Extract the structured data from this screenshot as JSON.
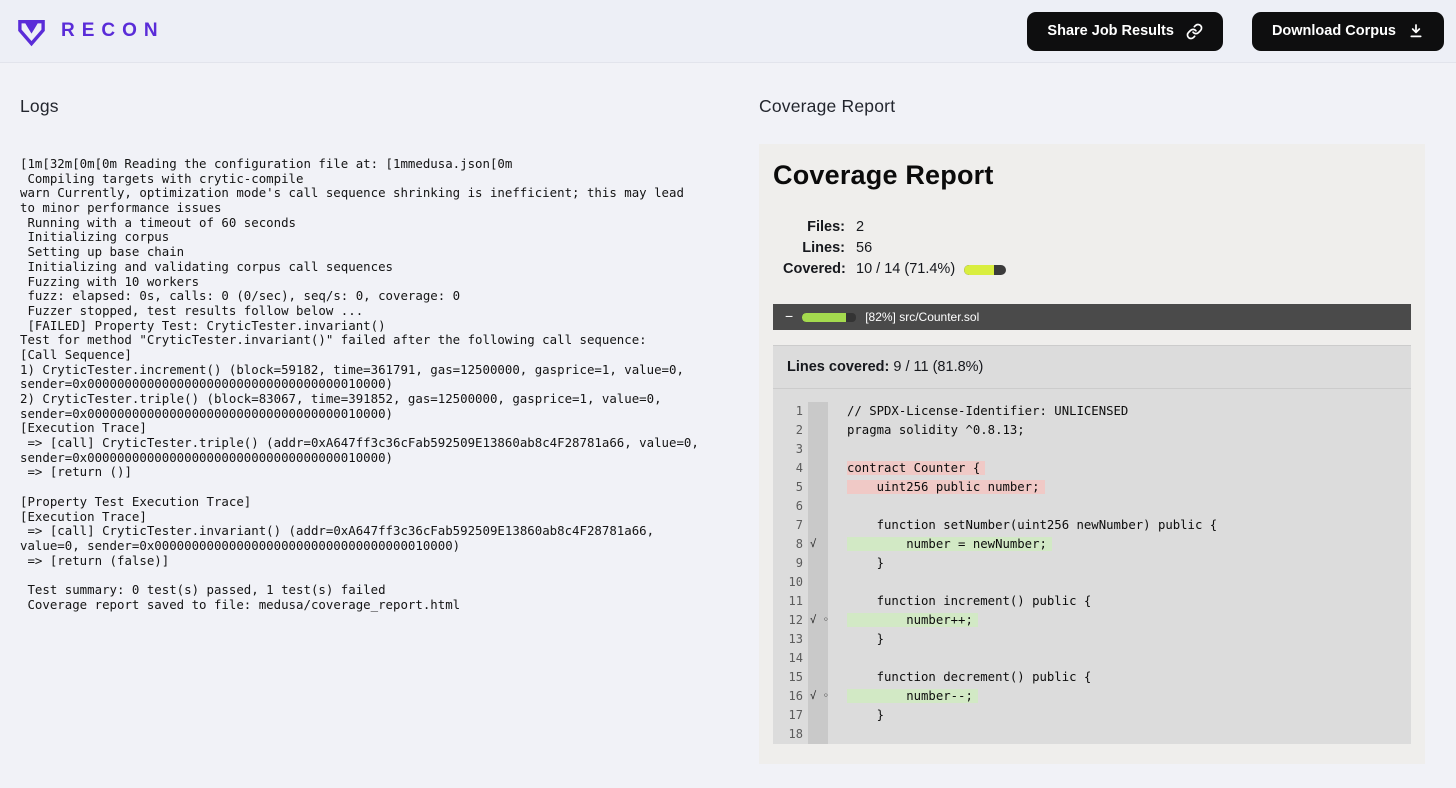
{
  "colors": {
    "accent_purple": "#5a2cd8",
    "button_black": "#0e0e0f",
    "covered_bar_fill": "#d9ee3f",
    "file_bar_fill": "#a4da4e",
    "uncovered_line_bg": "#f0c9c6",
    "covered_line_bg": "#d2e9c5",
    "file_header_bg": "#4a4a4a"
  },
  "navbar": {
    "brand": "RECON",
    "share_button_label": "Share Job Results",
    "download_button_label": "Download Corpus"
  },
  "logs": {
    "title": "Logs",
    "lines": [
      "[1m[32m[0m[0m Reading the configuration file at: [1mmedusa.json[0m",
      " Compiling targets with crytic-compile",
      "warn Currently, optimization mode's call sequence shrinking is inefficient; this may lead to minor performance issues",
      " Running with a timeout of 60 seconds",
      " Initializing corpus",
      " Setting up base chain",
      " Initializing and validating corpus call sequences",
      " Fuzzing with 10 workers",
      " fuzz: elapsed: 0s, calls: 0 (0/sec), seq/s: 0, coverage: 0",
      " Fuzzer stopped, test results follow below ...",
      " [FAILED] Property Test: CryticTester.invariant()",
      "Test for method \"CryticTester.invariant()\" failed after the following call sequence:",
      "[Call Sequence]",
      "1) CryticTester.increment() (block=59182, time=361791, gas=12500000, gasprice=1, value=0, sender=0x0000000000000000000000000000000000010000)",
      "2) CryticTester.triple() (block=83067, time=391852, gas=12500000, gasprice=1, value=0, sender=0x0000000000000000000000000000000000010000)",
      "[Execution Trace]",
      " => [call] CryticTester.triple() (addr=0xA647ff3c36cFab592509E13860ab8c4F28781a66, value=0, sender=0x0000000000000000000000000000000000010000)",
      " => [return ()]",
      "",
      "[Property Test Execution Trace]",
      "[Execution Trace]",
      " => [call] CryticTester.invariant() (addr=0xA647ff3c36cFab592509E13860ab8c4F28781a66, value=0, sender=0x0000000000000000000000000000000000010000)",
      " => [return (false)]",
      "",
      " Test summary: 0 test(s) passed, 1 test(s) failed",
      " Coverage report saved to file: medusa/coverage_report.html"
    ]
  },
  "coverage": {
    "section_title": "Coverage Report",
    "card_title": "Coverage Report",
    "stats": [
      {
        "label": "Files:",
        "value": "2",
        "progress_pct": null
      },
      {
        "label": "Lines:",
        "value": "56",
        "progress_pct": null
      },
      {
        "label": "Covered:",
        "value": "10 / 14 (71.4%)",
        "progress_pct": 71.4
      }
    ],
    "file": {
      "collapse_glyph": "−",
      "progress_pct": 82,
      "header_label": "[82%] src/Counter.sol",
      "lines_covered_label": "Lines covered:",
      "lines_covered_value": "9 / 11 (81.8%)"
    },
    "code": [
      {
        "n": 1,
        "text": "// SPDX-License-Identifier: UNLICENSED",
        "hl": null,
        "marks": ""
      },
      {
        "n": 2,
        "text": "pragma solidity ^0.8.13;",
        "hl": null,
        "marks": ""
      },
      {
        "n": 3,
        "text": "",
        "hl": null,
        "marks": ""
      },
      {
        "n": 4,
        "text": "contract Counter {",
        "hl": "red",
        "marks": ""
      },
      {
        "n": 5,
        "text": "    uint256 public number;",
        "hl": "red",
        "marks": ""
      },
      {
        "n": 6,
        "text": "",
        "hl": null,
        "marks": ""
      },
      {
        "n": 7,
        "text": "    function setNumber(uint256 newNumber) public {",
        "hl": null,
        "marks": ""
      },
      {
        "n": 8,
        "text": "        number = newNumber;",
        "hl": "green",
        "marks": "√"
      },
      {
        "n": 9,
        "text": "    }",
        "hl": null,
        "marks": ""
      },
      {
        "n": 10,
        "text": "",
        "hl": null,
        "marks": ""
      },
      {
        "n": 11,
        "text": "    function increment() public {",
        "hl": null,
        "marks": ""
      },
      {
        "n": 12,
        "text": "        number++;",
        "hl": "green",
        "marks": "√ ◦"
      },
      {
        "n": 13,
        "text": "    }",
        "hl": null,
        "marks": ""
      },
      {
        "n": 14,
        "text": "",
        "hl": null,
        "marks": ""
      },
      {
        "n": 15,
        "text": "    function decrement() public {",
        "hl": null,
        "marks": ""
      },
      {
        "n": 16,
        "text": "        number--;",
        "hl": "green",
        "marks": "√ ◦"
      },
      {
        "n": 17,
        "text": "    }",
        "hl": null,
        "marks": ""
      },
      {
        "n": 18,
        "text": "",
        "hl": null,
        "marks": ""
      }
    ]
  }
}
